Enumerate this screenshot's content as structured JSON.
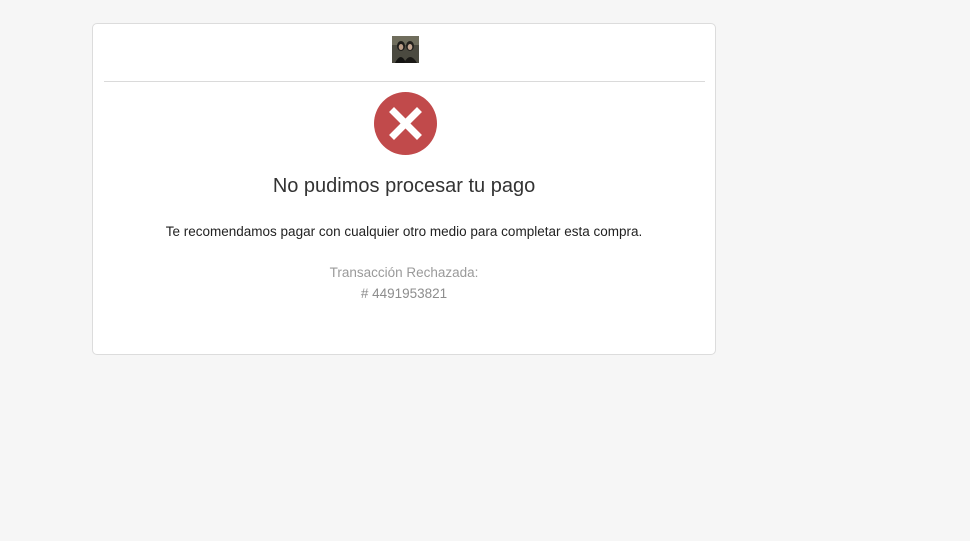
{
  "payment_result": {
    "status_icon": "error-x-circle-icon",
    "status_color": "#c14a4b",
    "title": "No pudimos procesar tu pago",
    "message": "Te recomendamos pagar con cualquier otro medio para completar esta compra.",
    "transaction_label": "Transacción Rechazada:",
    "transaction_number": "# 4491953821"
  },
  "merchant": {
    "logo": "merchant-photo-logo"
  }
}
